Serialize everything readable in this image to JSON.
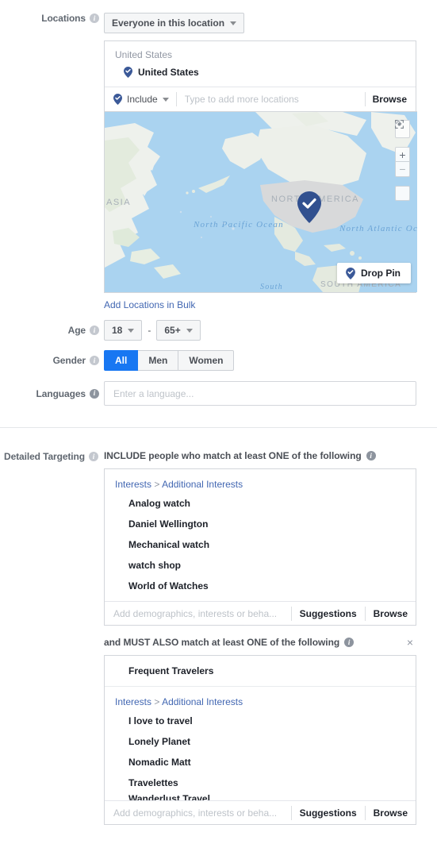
{
  "locations": {
    "label": "Locations",
    "scope_dropdown": "Everyone in this location",
    "group_title": "United States",
    "selected": "United States",
    "include_label": "Include",
    "search_placeholder": "Type to add more locations",
    "browse_label": "Browse",
    "bulk_link": "Add Locations in Bulk",
    "map": {
      "labels": {
        "asia": "ASIA",
        "north_america": "NORTH AMERICA",
        "south_america": "SOUTH AMERICA",
        "north_pacific": "North Pacific Ocean",
        "north_atlantic": "North Atlantic Ocean",
        "south": "South"
      },
      "drop_pin_label": "Drop Pin",
      "controls": {
        "compass": "compass-up",
        "zoom_in": "+",
        "zoom_out": "−",
        "expand": "expand"
      }
    }
  },
  "age": {
    "label": "Age",
    "min": "18",
    "separator": "-",
    "max": "65+"
  },
  "gender": {
    "label": "Gender",
    "options": [
      "All",
      "Men",
      "Women"
    ],
    "selected": "All"
  },
  "languages": {
    "label": "Languages",
    "placeholder": "Enter a language...",
    "value": ""
  },
  "detailed_targeting": {
    "label": "Detailed Targeting",
    "include_heading": "INCLUDE people who match at least ONE of the following",
    "must_also_heading": "and MUST ALSO match at least ONE of the following",
    "input_placeholder": "Add demographics, interests or beha...",
    "suggestions_label": "Suggestions",
    "browse_label": "Browse",
    "close_label": "×",
    "include_group": {
      "breadcrumb_root": "Interests",
      "breadcrumb_sep": ">",
      "breadcrumb_leaf": "Additional Interests",
      "items": [
        "Analog watch",
        "Daniel Wellington",
        "Mechanical watch",
        "watch shop",
        "World of Watches"
      ]
    },
    "must_group": {
      "top_item": "Frequent Travelers",
      "breadcrumb_root": "Interests",
      "breadcrumb_sep": ">",
      "breadcrumb_leaf": "Additional Interests",
      "items": [
        "I love to travel",
        "Lonely Planet",
        "Nomadic Matt",
        "Travelettes"
      ],
      "clipped_item": "Wanderlust Travel"
    }
  },
  "colors": {
    "accent_blue": "#1877f2",
    "link_blue": "#4267b2",
    "pin_blue": "#3b5998",
    "text_dark": "#1d2129",
    "text_muted": "#606770",
    "placeholder": "#bec3c9",
    "border": "#d3d6db",
    "map_water": "#aad3f0"
  }
}
